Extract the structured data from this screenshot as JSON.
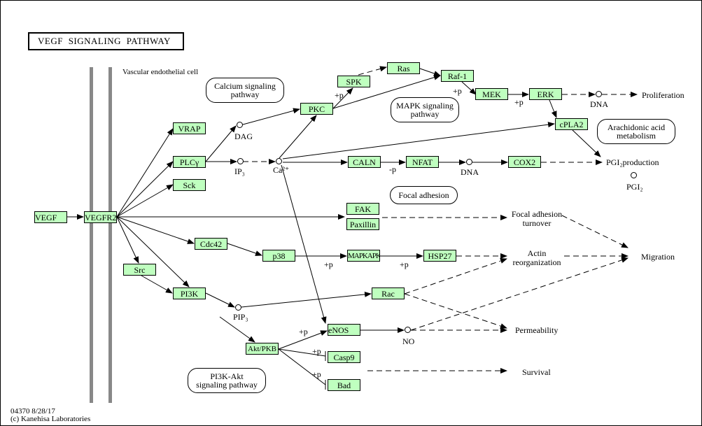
{
  "title": "VEGF  SIGNALING  PATHWAY",
  "cell_label": "Vascular endothelial cell",
  "colors": {
    "gene_fill": "#bfffbf",
    "membrane": "#888888"
  },
  "genes": {
    "vegf": "VEGF",
    "vegfr2": "VEGFR2",
    "vrap": "VRAP",
    "plcy": "PLCγ",
    "sck": "Sck",
    "pkc": "PKC",
    "spk": "SPK",
    "ras": "Ras",
    "raf1": "Raf-1",
    "mek": "MEK",
    "erk": "ERK",
    "cpla2": "cPLA2",
    "caln": "CALN",
    "nfat": "NFAT",
    "cox2": "COX2",
    "fak": "FAK",
    "paxillin": "Paxillin",
    "cdc42": "Cdc42",
    "p38": "p38",
    "mapkapk": "MAPKAPK",
    "hsp27": "HSP27",
    "src": "Src",
    "pi3k": "PI3K",
    "rac": "Rac",
    "akt": "Akt/PKB",
    "enos": "eNOS",
    "casp9": "Casp9",
    "bad": "Bad"
  },
  "maps": {
    "calcium": "Calcium signaling pathway",
    "calcium_l1": "Calcium signaling",
    "calcium_l2": "pathway",
    "mapk_l1": "MAPK signaling",
    "mapk_l2": "pathway",
    "arach_l1": "Arachidonic acid",
    "arach_l2": "metabolism",
    "focal": "Focal adhesion",
    "pi3k_l1": "PI3K-Akt",
    "pi3k_l2": "signaling pathway"
  },
  "compounds": {
    "dag": "DAG",
    "ip3": "IP₃",
    "ca": "Ca²⁺",
    "dna1": "DNA",
    "dna2": "DNA",
    "pip3": "PIP₃",
    "no": "NO",
    "pgi2": "PGI₂"
  },
  "outputs": {
    "proliferation": "Proliferation",
    "pgi2_production": "PGI₂production",
    "focal_turnover_l1": "Focal adhesion",
    "focal_turnover_l2": "turnover",
    "actin_l1": "Actin",
    "actin_l2": "reorganization",
    "migration": "Migration",
    "permeability": "Permeability",
    "survival": "Survival"
  },
  "edge_labels": {
    "p_spk": "+p",
    "p_raf": "+p",
    "p_mek": "+p",
    "p_caln": "-p",
    "p_mapkapk": "+p",
    "p_hsp": "+p",
    "p_enos": "+p",
    "p_casp9": "+p",
    "p_bad": "+p"
  },
  "footer": {
    "line1": "04370 8/28/17",
    "line2": "(c) Kanehisa Laboratories"
  }
}
